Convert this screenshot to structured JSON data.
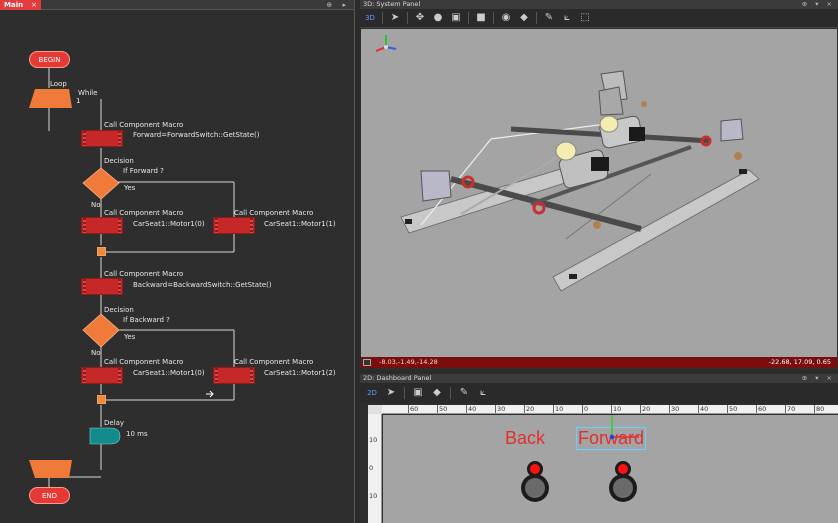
{
  "main_tab": {
    "label": "Main",
    "close": "×",
    "controls": "⊕ ▸"
  },
  "flow": {
    "begin": "BEGIN",
    "end": "END",
    "loop_label": "Loop",
    "loop_cond_label": "While",
    "loop_cond_value": "1",
    "macro1_title": "Call Component Macro",
    "macro1_text": "Forward=ForwardSwitch::GetState()",
    "decision1_title": "Decision",
    "decision1_text": "If Forward ?",
    "decision1_yes": "Yes",
    "decision1_no": "No",
    "macro2_title": "Call Component Macro",
    "macro2_text": "CarSeat1::Motor1(0)",
    "macro3_title": "Call Component Macro",
    "macro3_text": "CarSeat1::Motor1(1)",
    "macro4_title": "Call Component Macro",
    "macro4_text": "Backward=BackwardSwitch::GetState()",
    "decision2_title": "Decision",
    "decision2_text": "If Backward ?",
    "decision2_yes": "Yes",
    "decision2_no": "No",
    "macro5_title": "Call Component Macro",
    "macro5_text": "CarSeat1::Motor1(0)",
    "macro6_title": "Call Component Macro",
    "macro6_text": "CarSeat1::Motor1(2)",
    "delay_title": "Delay",
    "delay_text": "10 ms"
  },
  "system_panel": {
    "title": "3D: System Panel",
    "controls": "⊕ ▾ ×",
    "toolbar_label": "3D",
    "status_left": "-8.03,-1.49,-14.28",
    "status_right": "-22.68, 17.09, 0.65"
  },
  "dashboard_panel": {
    "title": "2D: Dashboard Panel",
    "controls": "⊕ ▾ ×",
    "toolbar_label": "2D",
    "back_label": "Back",
    "forward_label": "Forward",
    "ruler_top": [
      "60",
      "50",
      "40",
      "30",
      "20",
      "10",
      "0",
      "10",
      "20",
      "30",
      "40",
      "50",
      "60",
      "70",
      "80"
    ],
    "ruler_left": [
      "10",
      "0",
      "10"
    ]
  },
  "colors": {
    "accent": "#e23c3c",
    "flow_terminal": "#e53935",
    "flow_macro": "#c62828",
    "flow_decision": "#f07a3a",
    "flow_delay": "#138b8b",
    "viewport_bg": "#a4a4a4"
  },
  "icons": [
    "pointer-icon",
    "cube-icon",
    "sphere-icon",
    "camera-icon",
    "axes-icon",
    "wrench-icon",
    "gear-icon"
  ]
}
